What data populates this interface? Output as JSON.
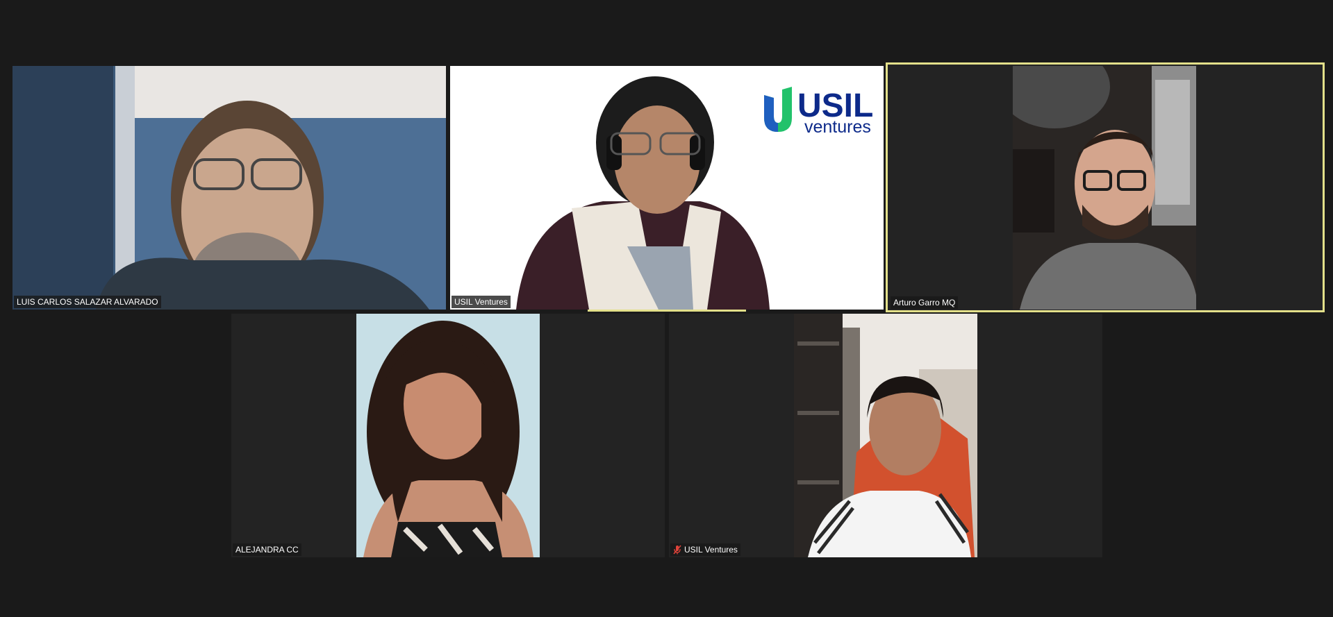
{
  "meeting": {
    "participants": [
      {
        "id": "p1",
        "name": "LUIS CARLOS SALAZAR ALVARADO",
        "muted": false,
        "active_speaker": false
      },
      {
        "id": "p2",
        "name": "USIL Ventures",
        "muted": false,
        "active_speaker": false,
        "virtual_background_logo": {
          "brand": "USIL",
          "tagline": "ventures"
        }
      },
      {
        "id": "p3",
        "name": "Arturo Garro MQ",
        "muted": false,
        "active_speaker": true
      },
      {
        "id": "p4",
        "name": "ALEJANDRA CC",
        "muted": false,
        "active_speaker": false
      },
      {
        "id": "p5",
        "name": "USIL Ventures",
        "muted": true,
        "active_speaker": false
      }
    ]
  },
  "colors": {
    "background": "#1a1a1a",
    "tile_background": "#232323",
    "active_speaker_border": "#e3e08a",
    "usil_blue": "#0d2a8a",
    "usil_green": "#22c26b",
    "mute_red": "#e0433a"
  },
  "icons": {
    "mute": "microphone-muted-icon"
  }
}
